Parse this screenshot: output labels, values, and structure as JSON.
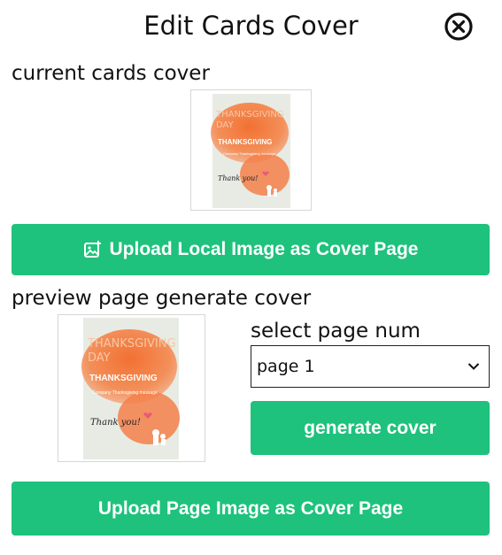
{
  "dialog": {
    "title": "Edit Cards Cover"
  },
  "current_cover": {
    "label": "current cards cover",
    "card": {
      "heading_1": "THANKSGIVING",
      "heading_2": "DAY",
      "subtitle": "THANKSGIVING",
      "message": "Company Thanksgiving message",
      "signature": "Thank you!"
    }
  },
  "upload_local_button": {
    "label": "Upload Local Image as Cover Page",
    "icon": "image-plus-icon"
  },
  "preview_cover": {
    "label": "preview page generate cover",
    "card": {
      "heading_1": "THANKSGIVING",
      "heading_2": "DAY",
      "subtitle": "THANKSGIVING",
      "message": "Company Thanksgiving message",
      "signature": "Thank you!"
    }
  },
  "page_select": {
    "label": "select page num",
    "selected": "page 1"
  },
  "generate_button": {
    "label": "generate cover"
  },
  "upload_page_button": {
    "label": "Upload Page Image as Cover Page"
  },
  "colors": {
    "accent": "#1ec27c",
    "card_orange": "#f26b2a",
    "card_bg": "#e8ece6"
  }
}
